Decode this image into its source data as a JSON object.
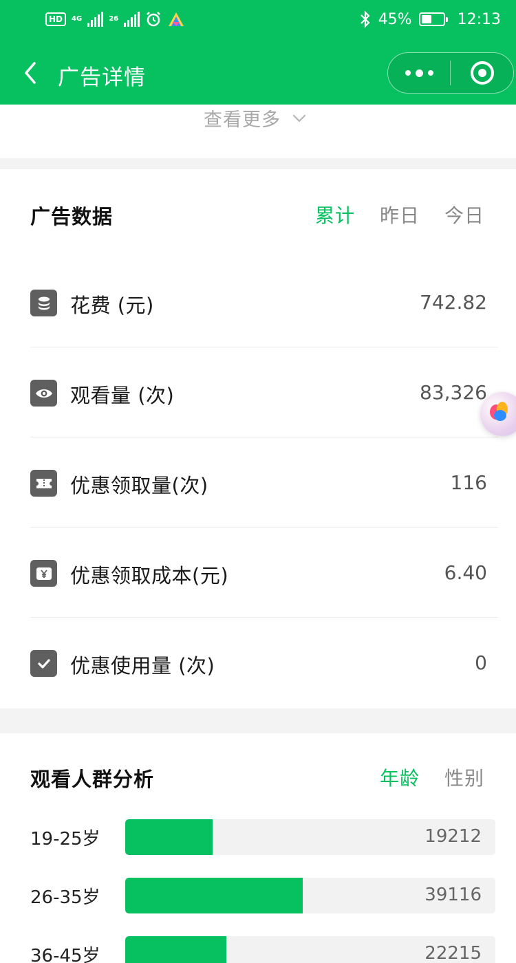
{
  "status_bar": {
    "hd": "HD",
    "net1": "4G",
    "net2": "26",
    "bluetooth_icon": "bluetooth-icon",
    "battery_percent": "45%",
    "battery_level": 0.45,
    "time": "12:13"
  },
  "nav": {
    "title": "广告详情",
    "back_icon": "chevron-left-icon",
    "more_icon": "more-dots-icon",
    "close_icon": "target-circle-icon"
  },
  "summary": {
    "see_more": "查看更多"
  },
  "ad_data": {
    "title": "广告数据",
    "tabs": [
      {
        "label": "累计",
        "active": true
      },
      {
        "label": "昨日",
        "active": false
      },
      {
        "label": "今日",
        "active": false
      }
    ],
    "metrics": [
      {
        "icon": "coins-stack-icon",
        "label": "花费 (元)",
        "value": "742.82"
      },
      {
        "icon": "eye-icon",
        "label": "观看量 (次)",
        "value": "83,326"
      },
      {
        "icon": "ticket-icon",
        "label": "优惠领取量(次)",
        "value": "116"
      },
      {
        "icon": "yen-card-icon",
        "label": "优惠领取成本(元)",
        "value": "6.40"
      },
      {
        "icon": "checkbox-icon",
        "label": "优惠使用量 (次)",
        "value": "0"
      }
    ]
  },
  "audience": {
    "title": "观看人群分析",
    "tabs": [
      {
        "label": "年龄",
        "active": true
      },
      {
        "label": "性别",
        "active": false
      }
    ],
    "accent_color": "#07c160",
    "chart_data": {
      "type": "bar",
      "categories": [
        "19-25岁",
        "26-35岁",
        "36-45岁"
      ],
      "values": [
        19212,
        39116,
        22215
      ],
      "xlim": [
        0,
        81543
      ]
    }
  }
}
